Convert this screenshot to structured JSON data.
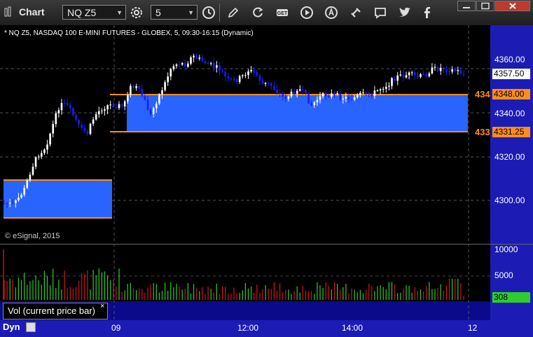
{
  "window": {
    "title": "Chart"
  },
  "toolbar": {
    "symbol": "NQ Z5",
    "interval": "5",
    "icons": [
      "settings-gear-icon",
      "clock-icon",
      "pencil-icon",
      "refresh-icon",
      "get-icon",
      "play-icon",
      "alert-icon",
      "link-icon",
      "comment-icon",
      "twitter-icon",
      "facebook-icon"
    ]
  },
  "chart": {
    "symbol_info": "* NQ Z5, NASDAQ 100 E-MINI FUTURES - GLOBEX, 5, 09:30-16:15 (Dynamic)",
    "copyright": "© eSignal, 2015",
    "price_axis_labels": [
      "4360.00",
      "4340.00",
      "4320.00",
      "4300.00"
    ],
    "current_price": "4357.50",
    "zone_upper_tag": "4348.00",
    "zone_lower_tag": "4331.25",
    "zone_upper_short": "434",
    "zone_lower_short": "433",
    "time_labels": [
      "09",
      "12:00",
      "14:00",
      "12"
    ]
  },
  "volume": {
    "axis_labels": [
      "10000",
      "5000"
    ],
    "current": "308",
    "label": "Vol (current price bar)",
    "close": "×"
  },
  "footer": {
    "mode": "Dyn"
  },
  "colors": {
    "zone": "#2a64ff",
    "zone_border": "#ff8c1a",
    "up": "#ffffff",
    "down": "#1a1aff",
    "vol_up": "#2ecc2e",
    "vol_down": "#d01818",
    "axis_bg": "#1c1cb5"
  }
}
